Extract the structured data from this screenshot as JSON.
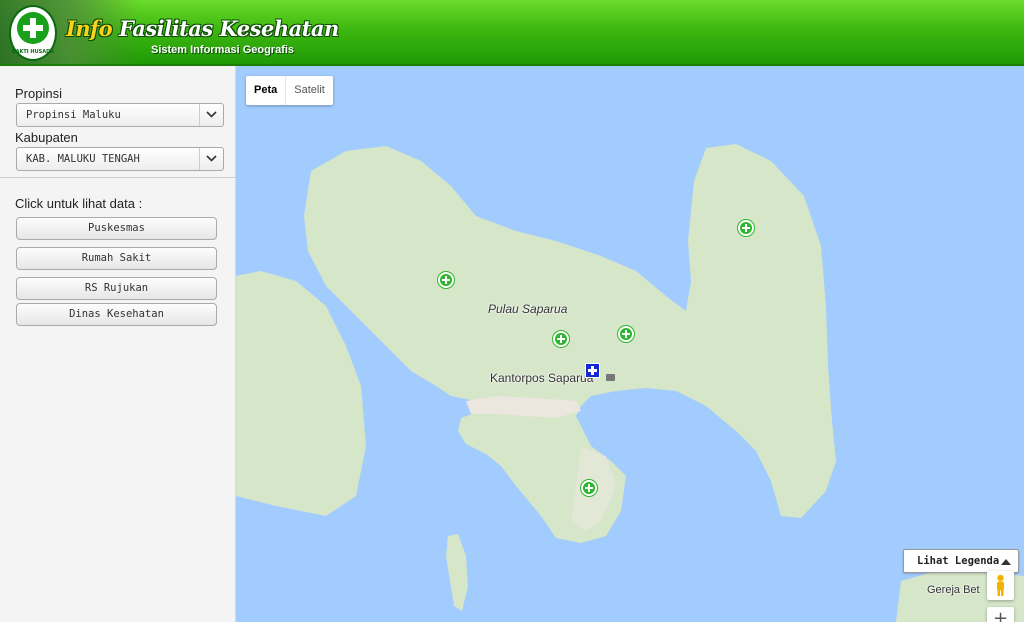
{
  "header": {
    "brand_part1": "Info",
    "brand_part2": " Fasilitas Kesehatan",
    "subtitle": "Sistem Informasi Geografis",
    "logo_text": "BAKTI HUSADA",
    "colors": {
      "brand_green": "#3fb810",
      "brand_yellow": "#ffd21a"
    }
  },
  "sidebar": {
    "propinsi_label": "Propinsi",
    "propinsi_value": "Propinsi Maluku",
    "kabupaten_label": "Kabupaten",
    "kabupaten_value": "KAB. MALUKU TENGAH",
    "click_label": "Click untuk lihat data :",
    "buttons": [
      {
        "label": "Puskesmas"
      },
      {
        "label": "Rumah Sakit"
      },
      {
        "label": "RS Rujukan"
      },
      {
        "label": "Dinas Kesehatan"
      }
    ]
  },
  "map": {
    "type_controls": {
      "map": "Peta",
      "satellite": "Satelit"
    },
    "labels": {
      "island": "Pulau Saparua",
      "post_office": "Kantorpos Saparua",
      "church": "Gereja Bet"
    },
    "legend_button": "Lihat Legenda",
    "zoom_in": "+",
    "colors": {
      "water": "#a3ccfe",
      "land": "#d5e6c9",
      "puskesmas_marker": "#2fb52f",
      "dinas_marker": "#1428d6"
    }
  }
}
